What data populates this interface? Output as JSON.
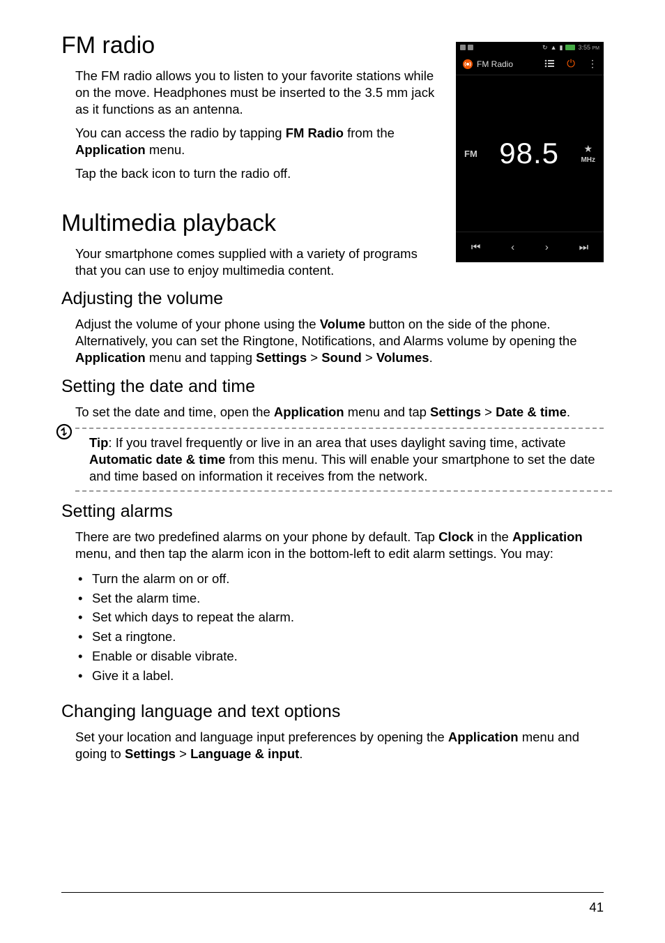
{
  "heading_fm_radio": "FM radio",
  "fm_radio_p1_a": "The FM radio allows you to listen to your favorite stations while on the move. Headphones must be inserted to the 3.5 mm jack as it functions as an antenna.",
  "fm_radio_p2_a": "You can access the radio by tapping ",
  "fm_radio_p2_b": "FM Radio",
  "fm_radio_p2_c": " from the ",
  "fm_radio_p2_d": "Application",
  "fm_radio_p2_e": " menu.",
  "fm_radio_p3": "Tap the back icon to turn the radio off.",
  "heading_multimedia": "Multimedia playback",
  "multimedia_p1": "Your smartphone comes supplied with a variety of programs that you can use to enjoy multimedia content.",
  "heading_volume": "Adjusting the volume",
  "volume_p1_a": "Adjust the volume of your phone using the ",
  "volume_p1_b": "Volume",
  "volume_p1_c": " button on the side of the phone. Alternatively, you can set the Ringtone, Notifications, and Alarms volume by opening the ",
  "volume_p1_d": "Application",
  "volume_p1_e": " menu and tapping ",
  "volume_p1_f": "Settings",
  "volume_p1_g": " > ",
  "volume_p1_h": "Sound",
  "volume_p1_i": " > ",
  "volume_p1_j": "Volumes",
  "volume_p1_k": ".",
  "heading_datetime": "Setting the date and time",
  "datetime_p1_a": "To set the date and time, open the ",
  "datetime_p1_b": "Application",
  "datetime_p1_c": " menu and tap ",
  "datetime_p1_d": "Settings",
  "datetime_p1_e": " > ",
  "datetime_p1_f": "Date & time",
  "datetime_p1_g": ".",
  "tip_a": "Tip",
  "tip_b": ": If you travel frequently or live in an area that uses daylight saving time, activate ",
  "tip_c": "Automatic date & time",
  "tip_d": " from this menu. This will enable your smartphone to set the date and time based on information it receives from the network.",
  "heading_alarms": "Setting alarms",
  "alarms_p1_a": "There are two predefined alarms on your phone by default. Tap ",
  "alarms_p1_b": "Clock",
  "alarms_p1_c": " in the ",
  "alarms_p1_d": "Application",
  "alarms_p1_e": " menu, and then tap the alarm icon in the bottom-left to edit alarm settings. You may:",
  "alarm_li1": "Turn the alarm on or off.",
  "alarm_li2": "Set the alarm time.",
  "alarm_li3": "Set which days to repeat the alarm.",
  "alarm_li4": "Set a ringtone.",
  "alarm_li5": "Enable or disable vibrate.",
  "alarm_li6": "Give it a label.",
  "heading_lang": "Changing language and text options",
  "lang_p1_a": "Set your location and language input preferences by opening the ",
  "lang_p1_b": "Application",
  "lang_p1_c": " menu and going to ",
  "lang_p1_d": "Settings",
  "lang_p1_e": " > ",
  "lang_p1_f": "Language & input",
  "lang_p1_g": ".",
  "page_number": "41",
  "phone": {
    "time": "3:55",
    "ampm": "PM",
    "app_title": "FM Radio",
    "fm_label": "FM",
    "frequency": "98.5",
    "mhz_label": "MHz",
    "star": "★",
    "prev_track": "⏮",
    "prev": "‹",
    "next": "›",
    "next_track": "⏭",
    "list": "☰",
    "power": "⏻",
    "more": "⋮",
    "sync": "↻",
    "wifi": "📶"
  }
}
